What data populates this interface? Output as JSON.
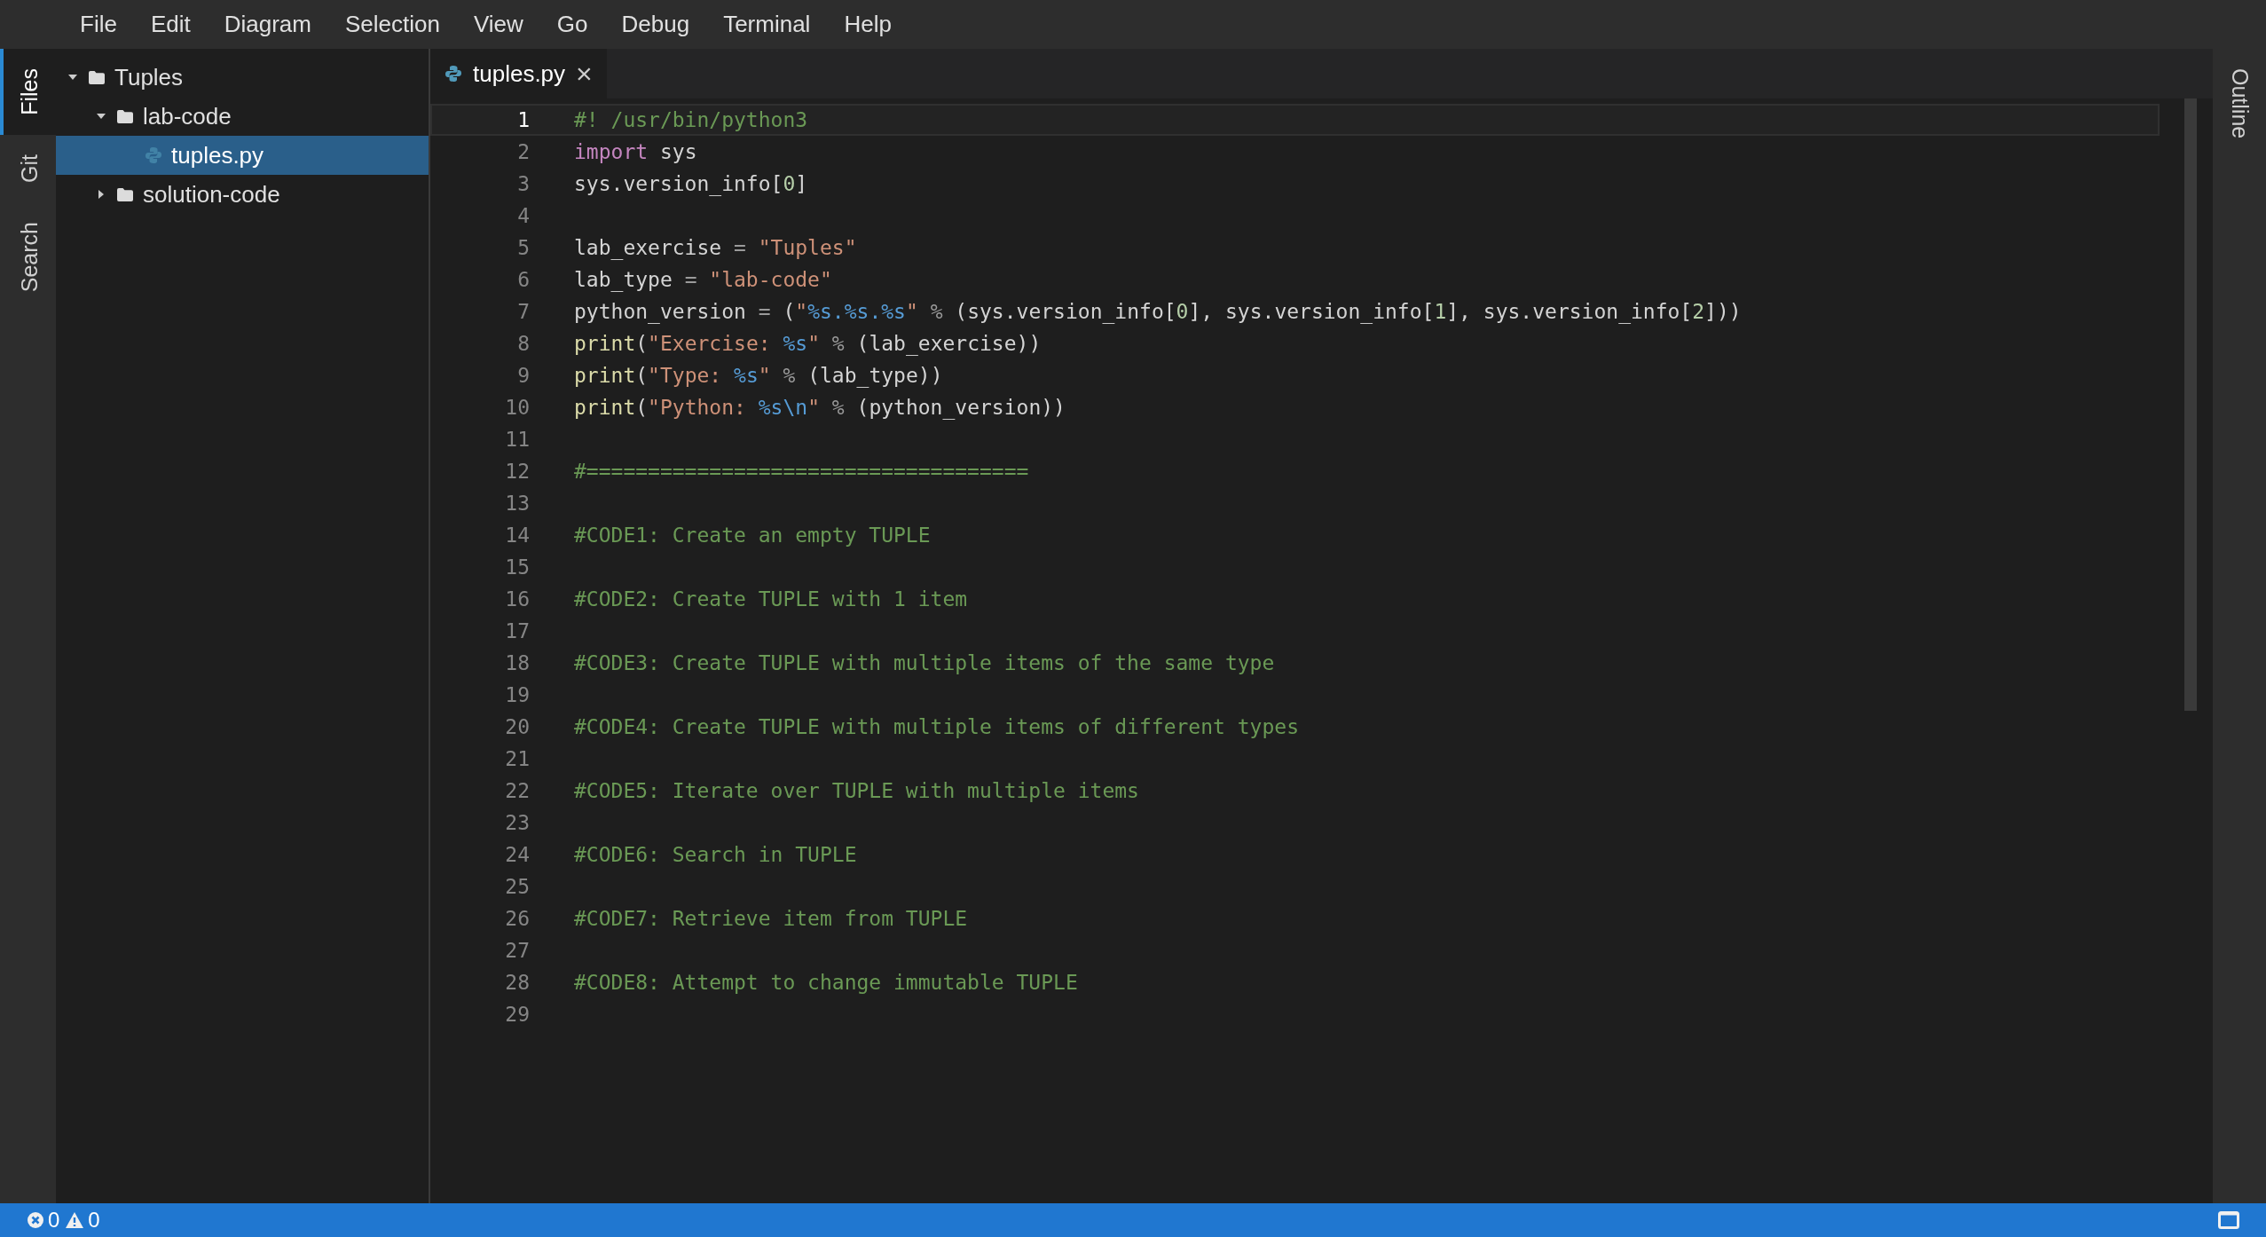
{
  "menu": [
    "File",
    "Edit",
    "Diagram",
    "Selection",
    "View",
    "Go",
    "Debug",
    "Terminal",
    "Help"
  ],
  "side_tabs": [
    {
      "label": "Files",
      "selected": true
    },
    {
      "label": "Git",
      "selected": false
    },
    {
      "label": "Search",
      "selected": false
    }
  ],
  "explorer": {
    "items": [
      {
        "kind": "folder",
        "label": "Tuples",
        "expanded": true,
        "selected": false,
        "children": [
          {
            "kind": "folder",
            "label": "lab-code",
            "expanded": true,
            "selected": false,
            "children": [
              {
                "kind": "python",
                "label": "tuples.py",
                "selected": true
              }
            ]
          },
          {
            "kind": "folder",
            "label": "solution-code",
            "expanded": false,
            "selected": false
          }
        ]
      }
    ]
  },
  "editor_tabs": [
    {
      "label": "tuples.py",
      "selected": true,
      "close": "×"
    }
  ],
  "code": [
    {
      "number": "1",
      "current": true,
      "tokens": [
        {
          "kind": "comment",
          "text": "#! /usr/bin/python3"
        }
      ]
    },
    {
      "number": "2",
      "current": false,
      "tokens": [
        {
          "kind": "keyword",
          "text": "import"
        },
        {
          "kind": "plain",
          "text": " sys"
        }
      ]
    },
    {
      "number": "3",
      "current": false,
      "tokens": [
        {
          "kind": "plain",
          "text": "sys.version_info["
        },
        {
          "kind": "number",
          "text": "0"
        },
        {
          "kind": "plain",
          "text": "]"
        }
      ]
    },
    {
      "number": "4",
      "current": false
    },
    {
      "number": "5",
      "current": false,
      "tokens": [
        {
          "kind": "plain",
          "text": "lab_exercise "
        },
        {
          "kind": "operator",
          "text": "= "
        },
        {
          "kind": "string",
          "text": "\"Tuples\""
        }
      ]
    },
    {
      "number": "6",
      "current": false,
      "tokens": [
        {
          "kind": "plain",
          "text": "lab_type "
        },
        {
          "kind": "operator",
          "text": "= "
        },
        {
          "kind": "string",
          "text": "\"lab-code\""
        }
      ]
    },
    {
      "number": "7",
      "current": false,
      "tokens": [
        {
          "kind": "plain",
          "text": "python_version "
        },
        {
          "kind": "operator",
          "text": "="
        },
        {
          "kind": "plain",
          "text": " ("
        },
        {
          "kind": "string",
          "text": "\""
        },
        {
          "kind": "format",
          "text": "%s.%s.%s"
        },
        {
          "kind": "string",
          "text": "\" "
        },
        {
          "kind": "operator",
          "text": "%"
        },
        {
          "kind": "plain",
          "text": " (sys.version_info["
        },
        {
          "kind": "number",
          "text": "0"
        },
        {
          "kind": "plain",
          "text": "], sys.version_info["
        },
        {
          "kind": "number",
          "text": "1"
        },
        {
          "kind": "plain",
          "text": "], sys.version_info["
        },
        {
          "kind": "number",
          "text": "2"
        },
        {
          "kind": "plain",
          "text": "]))"
        }
      ]
    },
    {
      "number": "8",
      "current": false,
      "tokens": [
        {
          "kind": "function",
          "text": "print"
        },
        {
          "kind": "plain",
          "text": "("
        },
        {
          "kind": "string",
          "text": "\"Exercise: "
        },
        {
          "kind": "format",
          "text": "%s"
        },
        {
          "kind": "string",
          "text": "\" "
        },
        {
          "kind": "operator",
          "text": "%"
        },
        {
          "kind": "plain",
          "text": " (lab_exercise))"
        }
      ]
    },
    {
      "number": "9",
      "current": false,
      "tokens": [
        {
          "kind": "function",
          "text": "print"
        },
        {
          "kind": "plain",
          "text": "("
        },
        {
          "kind": "string",
          "text": "\"Type: "
        },
        {
          "kind": "format",
          "text": "%s"
        },
        {
          "kind": "string",
          "text": "\" "
        },
        {
          "kind": "operator",
          "text": "%"
        },
        {
          "kind": "plain",
          "text": " (lab_type))"
        }
      ]
    },
    {
      "number": "10",
      "current": false,
      "tokens": [
        {
          "kind": "function",
          "text": "print"
        },
        {
          "kind": "plain",
          "text": "("
        },
        {
          "kind": "string",
          "text": "\"Python: "
        },
        {
          "kind": "format",
          "text": "%s\\n"
        },
        {
          "kind": "string",
          "text": "\" "
        },
        {
          "kind": "operator",
          "text": "%"
        },
        {
          "kind": "plain",
          "text": " (python_version))"
        }
      ]
    },
    {
      "number": "11",
      "current": false
    },
    {
      "number": "12",
      "current": false,
      "tokens": [
        {
          "kind": "comment",
          "text": "#===================================="
        }
      ]
    },
    {
      "number": "13",
      "current": false
    },
    {
      "number": "14",
      "current": false,
      "tokens": [
        {
          "kind": "comment",
          "text": "#CODE1: Create an empty TUPLE"
        }
      ]
    },
    {
      "number": "15",
      "current": false
    },
    {
      "number": "16",
      "current": false,
      "tokens": [
        {
          "kind": "comment",
          "text": "#CODE2: Create TUPLE with 1 item"
        }
      ]
    },
    {
      "number": "17",
      "current": false
    },
    {
      "number": "18",
      "current": false,
      "tokens": [
        {
          "kind": "comment",
          "text": "#CODE3: Create TUPLE with multiple items of the same type"
        }
      ]
    },
    {
      "number": "19",
      "current": false
    },
    {
      "number": "20",
      "current": false,
      "tokens": [
        {
          "kind": "comment",
          "text": "#CODE4: Create TUPLE with multiple items of different types"
        }
      ]
    },
    {
      "number": "21",
      "current": false
    },
    {
      "number": "22",
      "current": false,
      "tokens": [
        {
          "kind": "comment",
          "text": "#CODE5: Iterate over TUPLE with multiple items"
        }
      ]
    },
    {
      "number": "23",
      "current": false
    },
    {
      "number": "24",
      "current": false,
      "tokens": [
        {
          "kind": "comment",
          "text": "#CODE6: Search in TUPLE"
        }
      ]
    },
    {
      "number": "25",
      "current": false
    },
    {
      "number": "26",
      "current": false,
      "tokens": [
        {
          "kind": "comment",
          "text": "#CODE7: Retrieve item from TUPLE"
        }
      ]
    },
    {
      "number": "27",
      "current": false
    },
    {
      "number": "28",
      "current": false,
      "tokens": [
        {
          "kind": "comment",
          "text": "#CODE8: Attempt to change immutable TUPLE"
        }
      ]
    },
    {
      "number": "29",
      "current": false
    }
  ],
  "right_tabs": [
    {
      "label": "Outline",
      "selected": false
    }
  ],
  "status_bar": {
    "errors": "0",
    "warnings": "0"
  }
}
